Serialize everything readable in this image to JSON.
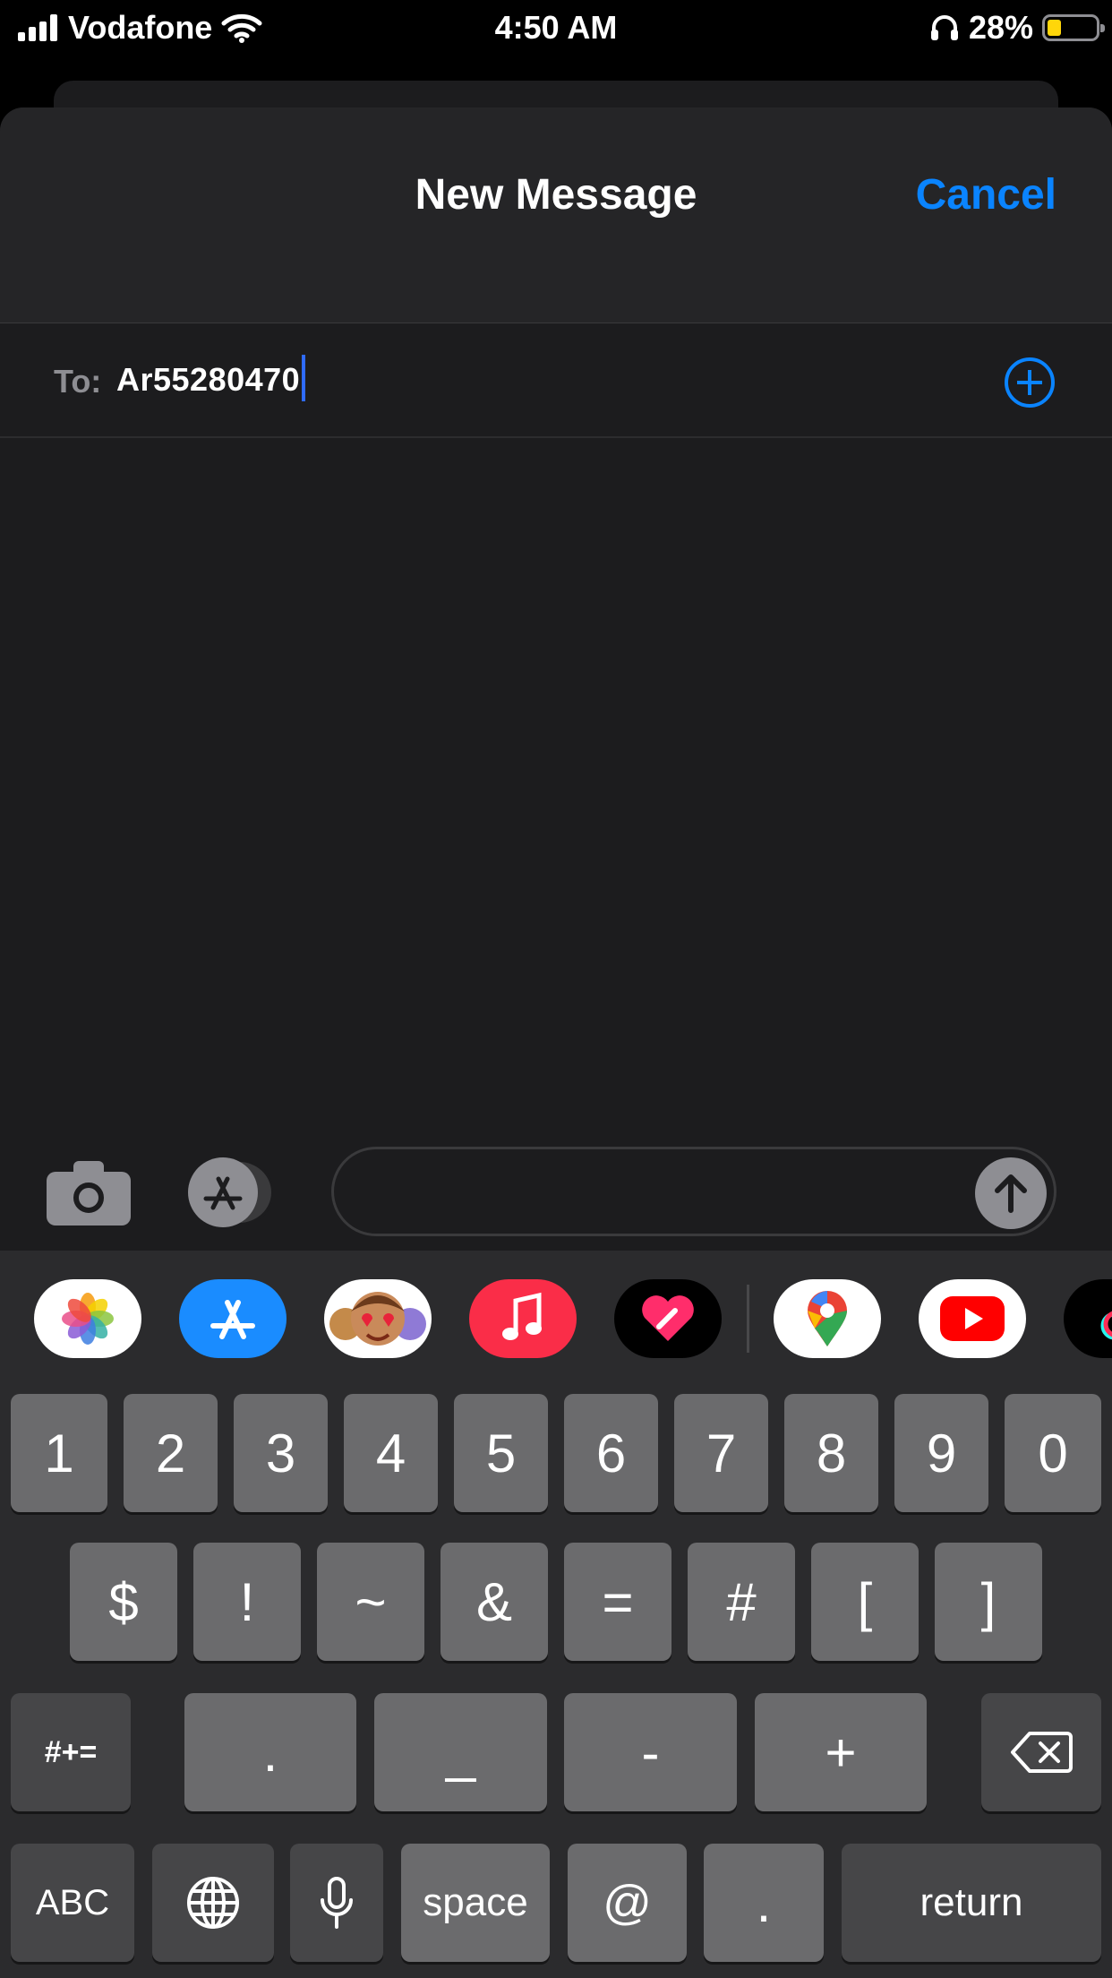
{
  "status_bar": {
    "carrier": "Vodafone",
    "time": "4:50 AM",
    "battery_percent": "28%",
    "battery_level": 0.28,
    "icons": [
      "signal-icon",
      "wifi-icon",
      "headphones-icon",
      "battery-icon"
    ]
  },
  "nav": {
    "title": "New Message",
    "cancel_label": "Cancel"
  },
  "to_field": {
    "label": "To:",
    "value": "Ar55280470"
  },
  "compose": {
    "message_value": "",
    "icons": [
      "camera-icon",
      "app-store-icon",
      "send-arrow-icon"
    ]
  },
  "app_strip": [
    {
      "name": "photos-app-icon",
      "bg": "#ffffff"
    },
    {
      "name": "app-store-app-icon",
      "bg": "#1a8cff"
    },
    {
      "name": "memoji-app-icon",
      "bg": "#ffffff"
    },
    {
      "name": "music-app-icon",
      "bg": "#fa2d48"
    },
    {
      "name": "digital-touch-app-icon",
      "bg": "#000000"
    },
    {
      "name": "google-maps-app-icon",
      "bg": "#ffffff"
    },
    {
      "name": "youtube-app-icon",
      "bg": "#ffffff"
    },
    {
      "name": "tiktok-app-icon",
      "bg": "#000000"
    }
  ],
  "keyboard": {
    "row1": [
      "1",
      "2",
      "3",
      "4",
      "5",
      "6",
      "7",
      "8",
      "9",
      "0"
    ],
    "row2": [
      "$",
      "!",
      "~",
      "&",
      "=",
      "#",
      "[",
      "]"
    ],
    "row3_toggle": "#+=",
    "row3": [
      ".",
      "_",
      "-",
      "+"
    ],
    "abc_label": "ABC",
    "space_label": "space",
    "at_label": "@",
    "dot_label": ".",
    "return_label": "return"
  },
  "colors": {
    "accent": "#0a84ff",
    "background": "#1c1c1e",
    "key": "#6b6b6d",
    "key_dark": "#464648"
  }
}
